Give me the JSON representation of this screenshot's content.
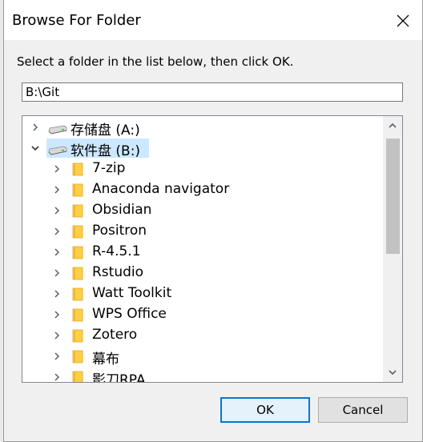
{
  "window": {
    "title": "Browse For Folder"
  },
  "instruction": "Select a folder in the list below, then click OK.",
  "path_field": {
    "value": "B:\\Git"
  },
  "tree": {
    "drives": [
      {
        "label": "存储盘 (A:)",
        "expanded": false,
        "selected": false
      },
      {
        "label": "软件盘 (B:)",
        "expanded": true,
        "selected": true
      }
    ],
    "folders": [
      "7-zip",
      "Anaconda navigator",
      "Obsidian",
      "Positron",
      "R-4.5.1",
      "Rstudio",
      "Watt Toolkit",
      "WPS Office",
      "Zotero",
      "幕布",
      "影刀RPA"
    ],
    "scroll_position": 0.0
  },
  "buttons": {
    "ok": "OK",
    "cancel": "Cancel"
  },
  "colors": {
    "accent": "#0078d7",
    "selection": "#cce8ff",
    "folder": "#ffcf48"
  }
}
